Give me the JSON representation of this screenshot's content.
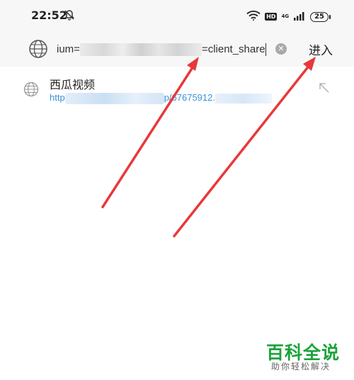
{
  "status_bar": {
    "time": "22:52",
    "hd_badge": "HD",
    "network": "4G",
    "battery": "25"
  },
  "url_bar": {
    "url_prefix": "ium=",
    "url_suffix": "=client_share",
    "enter_label": "进入"
  },
  "suggestion": {
    "title": "西瓜视频",
    "url_prefix": "http",
    "url_middle": "p/67675912."
  },
  "watermark": {
    "brand": "百科全说",
    "slogan": "助你轻松解决"
  },
  "colors": {
    "link_blue": "#3a8fd8",
    "arrow_red": "#e8383a",
    "watermark_green": "#1aa33a"
  },
  "icons": {
    "status": [
      "muted-bell-icon",
      "wifi-icon",
      "signal-icon",
      "battery-icon"
    ],
    "url_bar": [
      "globe-icon",
      "clear-icon"
    ],
    "suggestion": [
      "globe-icon",
      "fill-arrow-icon"
    ]
  }
}
